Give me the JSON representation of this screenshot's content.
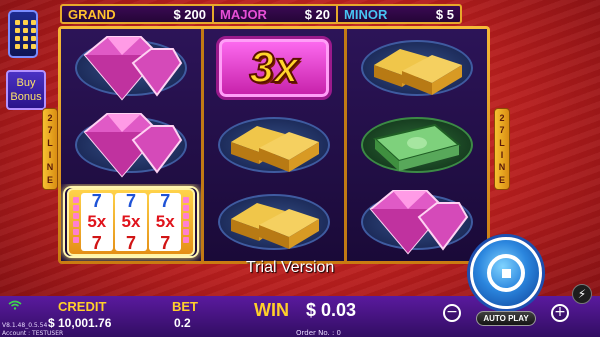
{
  "jackpots": {
    "grand": {
      "label": "GRAND",
      "value": "$ 200"
    },
    "major": {
      "label": "MAJOR",
      "value": "$ 20"
    },
    "minor": {
      "label": "MINOR",
      "value": "$ 5"
    }
  },
  "left_panel": {
    "menu_icon": "menu-grid-icon",
    "buy_bonus_line1": "Buy",
    "buy_bonus_line2": "Bonus"
  },
  "lines_badge": [
    "2",
    "7",
    "L",
    "I",
    "N",
    "E"
  ],
  "reels": [
    [
      "pink-diamond",
      "pink-diamond",
      "5x-slot-machine"
    ],
    [
      "3x-multiplier",
      "gold-bars",
      "gold-bars"
    ],
    [
      "gold-bars",
      "cash-stack",
      "pink-diamond"
    ]
  ],
  "multiplier_text": "3x",
  "slot_symbol": {
    "multiplier": "5x",
    "seven": "7"
  },
  "trial_text": "Trial Version",
  "credit": {
    "label": "CREDIT",
    "value": "$ 10,001.76"
  },
  "bet": {
    "label": "BET",
    "value": "0.2"
  },
  "win": {
    "label": "WIN",
    "value": "$ 0.03"
  },
  "order": "Order No. : 0",
  "version": "V8.1.48_0.5.54",
  "account": "Account : TESTUSER",
  "controls": {
    "minus": "−",
    "plus": "+",
    "auto_play": "AUTO PLAY",
    "turbo_icon": "lightning-icon",
    "spin_icon": "spin-stop-icon"
  },
  "colors": {
    "grand": "#ffc22d",
    "major": "#e64fd6",
    "minor": "#48c3f2",
    "label_gold": "#ffcf2a",
    "background_red": "#c32222"
  }
}
